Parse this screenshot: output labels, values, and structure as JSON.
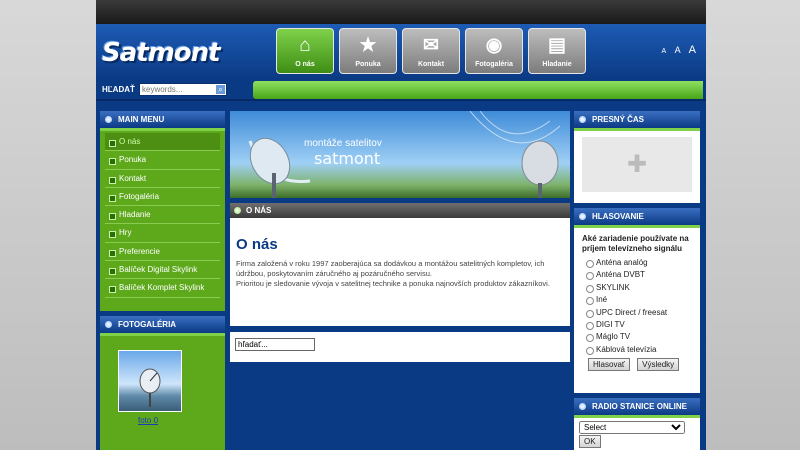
{
  "logo": "Satmont",
  "nav": [
    {
      "label": "O nás",
      "icon": "home-icon",
      "glyph": "⌂"
    },
    {
      "label": "Ponuka",
      "icon": "star-icon",
      "glyph": "★"
    },
    {
      "label": "Kontakt",
      "icon": "envelope-icon",
      "glyph": "✉"
    },
    {
      "label": "Fotogaléria",
      "icon": "globe-icon",
      "glyph": "◉"
    },
    {
      "label": "Hladanie",
      "icon": "photos-icon",
      "glyph": "▤"
    }
  ],
  "font_sizes": [
    "A",
    "A",
    "A"
  ],
  "search": {
    "label": "HĽADAŤ",
    "placeholder": "keywords..."
  },
  "main_menu": {
    "title": "MAIN MENU",
    "items": [
      "O nás",
      "Ponuka",
      "Kontakt",
      "Fotogaléria",
      "Hladanie",
      "Hry",
      "Preferencie",
      "Balíček Digital Skylink",
      "Balíček Komplet Skylink"
    ]
  },
  "gallery": {
    "title": "FOTOGALÉRIA",
    "link": "foto 0"
  },
  "banner": {
    "line1": "montáže satelitov",
    "line2": "satmont"
  },
  "content": {
    "section_title": "O NÁS",
    "heading": "O nás",
    "paragraph1": "Firma založená v roku 1997 zaoberajúca sa dodávkou a montážou satelitných kompletov, ich údržbou, poskytovaním záručného aj pozáručného servisu.",
    "paragraph2": "Prioritou je sledovanie vývoja v satelitnej technike a ponuka najnovších produktov zákazníkovi."
  },
  "search_box": {
    "value": "hľadať..."
  },
  "time_box": {
    "title": "PRESNÝ ČAS"
  },
  "poll": {
    "title": "HLASOVANIE",
    "question": "Aké zariadenie používate na príjem televízneho signálu",
    "options": [
      "Anténa analóg",
      "Anténa DVBT",
      "SKYLINK",
      "Iné",
      "UPC Direct / freesat",
      "DIGI TV",
      "Máglo TV",
      "Káblová televízia"
    ],
    "vote_button": "Hlasovať",
    "results_button": "Výsledky"
  },
  "radio": {
    "title": "RADIO STANICE ONLINE",
    "select_value": "Select",
    "ok_button": "OK"
  },
  "colors": {
    "brand_blue": "#0b3a84",
    "accent_green": "#5ea81c"
  }
}
